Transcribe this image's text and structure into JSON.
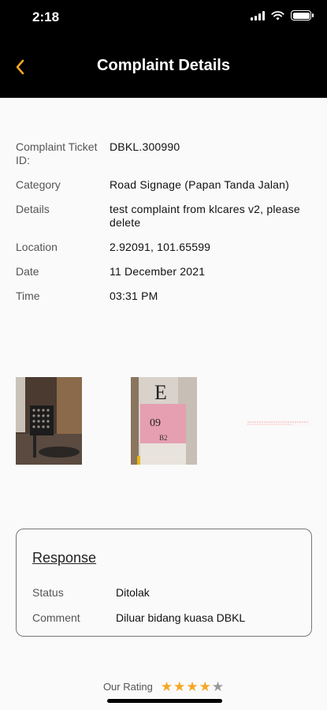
{
  "status_bar": {
    "time": "2:18"
  },
  "header": {
    "title": "Complaint Details",
    "back_icon": "chevron-left-icon",
    "accent": "#f5a623"
  },
  "details": [
    {
      "label": "Complaint Ticket ID:",
      "value": "DBKL.300990"
    },
    {
      "label": "Category",
      "value": "Road Signage (Papan Tanda Jalan)"
    },
    {
      "label": "Details",
      "value": "test complaint from klcares v2, please delete"
    },
    {
      "label": "Location",
      "value": "2.92091, 101.65599"
    },
    {
      "label": "Date",
      "value": "11 December 2021"
    },
    {
      "label": "Time",
      "value": "03:31 PM"
    }
  ],
  "photos": {
    "photo2_text_top": "E",
    "photo2_text_mid": "09",
    "photo2_text_bot": "B2"
  },
  "response": {
    "title": "Response",
    "status_label": "Status",
    "status_value": "Ditolak",
    "comment_label": "Comment",
    "comment_value": "Diluar bidang kuasa DBKL"
  },
  "rating": {
    "label": "Our Rating",
    "value": 4,
    "max": 5,
    "star_color": "#f5a623",
    "empty_color": "#999999"
  }
}
